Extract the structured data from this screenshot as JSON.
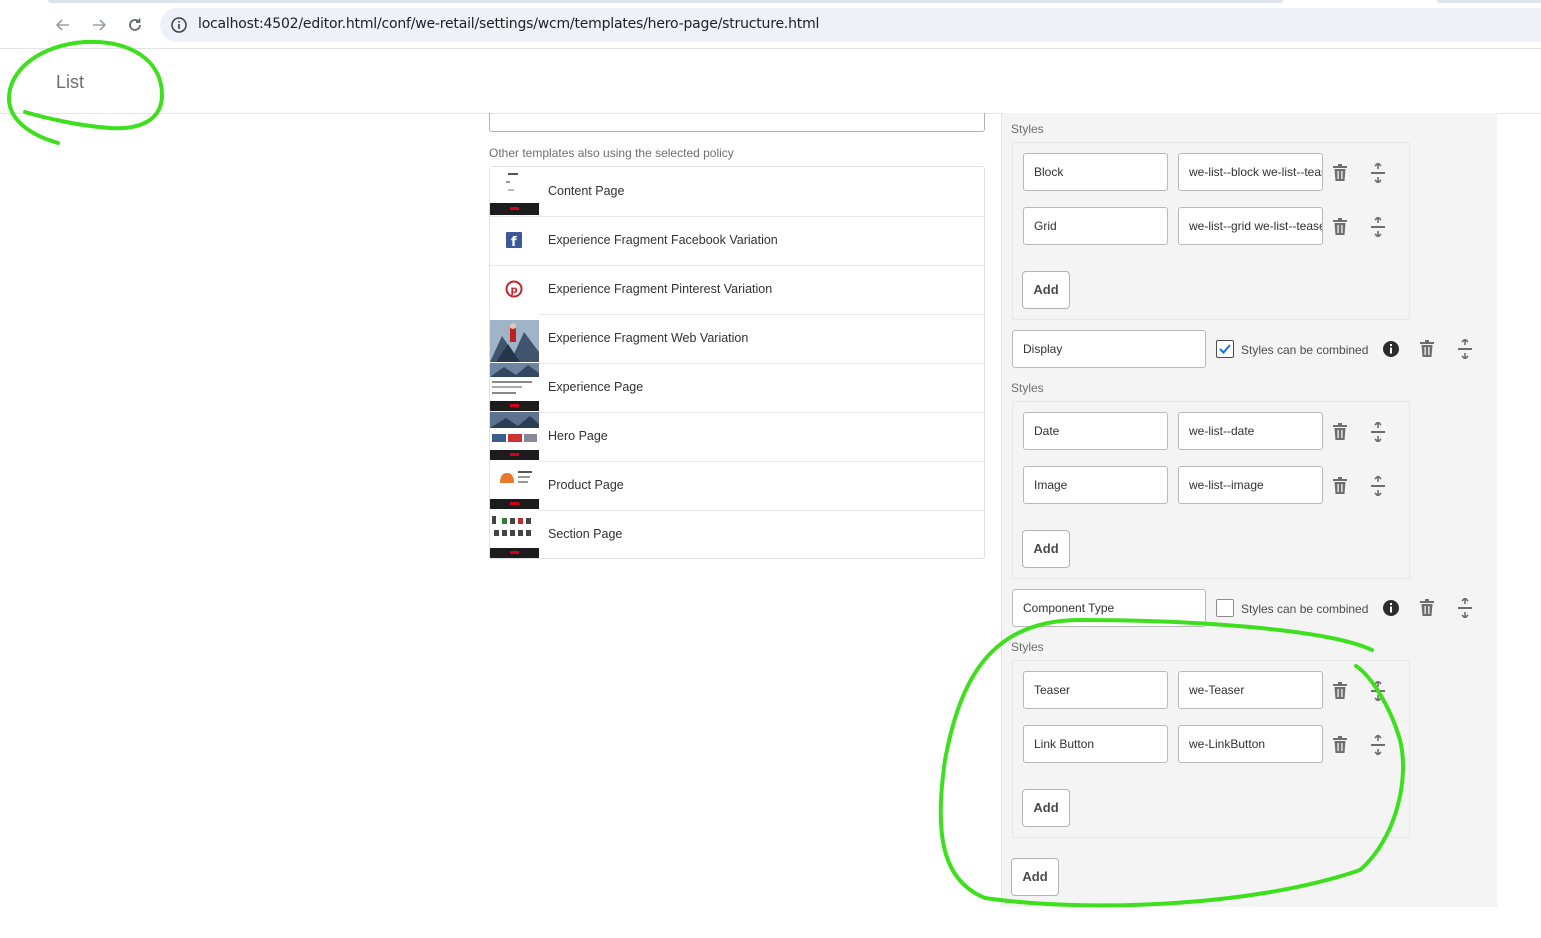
{
  "browser": {
    "url": "localhost:4502/editor.html/conf/we-retail/settings/wcm/templates/hero-page/structure.html"
  },
  "dialog": {
    "title": "List"
  },
  "templates_section": {
    "label": "Other templates also using the selected policy",
    "items": [
      {
        "label": "Content Page"
      },
      {
        "label": "Experience Fragment Facebook Variation"
      },
      {
        "label": "Experience Fragment Pinterest Variation"
      },
      {
        "label": "Experience Fragment Web Variation"
      },
      {
        "label": "Experience Page"
      },
      {
        "label": "Hero Page"
      },
      {
        "label": "Product Page"
      },
      {
        "label": "Section Page"
      }
    ]
  },
  "style_groups": {
    "styles_label": "Styles",
    "add_label": "Add",
    "combine_label": "Styles can be combined",
    "group1": {
      "styles": [
        {
          "name": "Block",
          "classes": "we-list--block we-list--teaser"
        },
        {
          "name": "Grid",
          "classes": "we-list--grid we-list--teaser"
        }
      ]
    },
    "group2": {
      "name": "Display",
      "combine_checked": true,
      "styles": [
        {
          "name": "Date",
          "classes": "we-list--date"
        },
        {
          "name": "Image",
          "classes": "we-list--image"
        }
      ]
    },
    "group3": {
      "name": "Component Type",
      "combine_checked": false,
      "styles": [
        {
          "name": "Teaser",
          "classes": "we-Teaser"
        },
        {
          "name": "Link Button",
          "classes": "we-LinkButton"
        }
      ]
    }
  },
  "colors": {
    "annotation": "#3ee01e",
    "facebook": "#3b5998",
    "pinterest": "#c8232c"
  }
}
